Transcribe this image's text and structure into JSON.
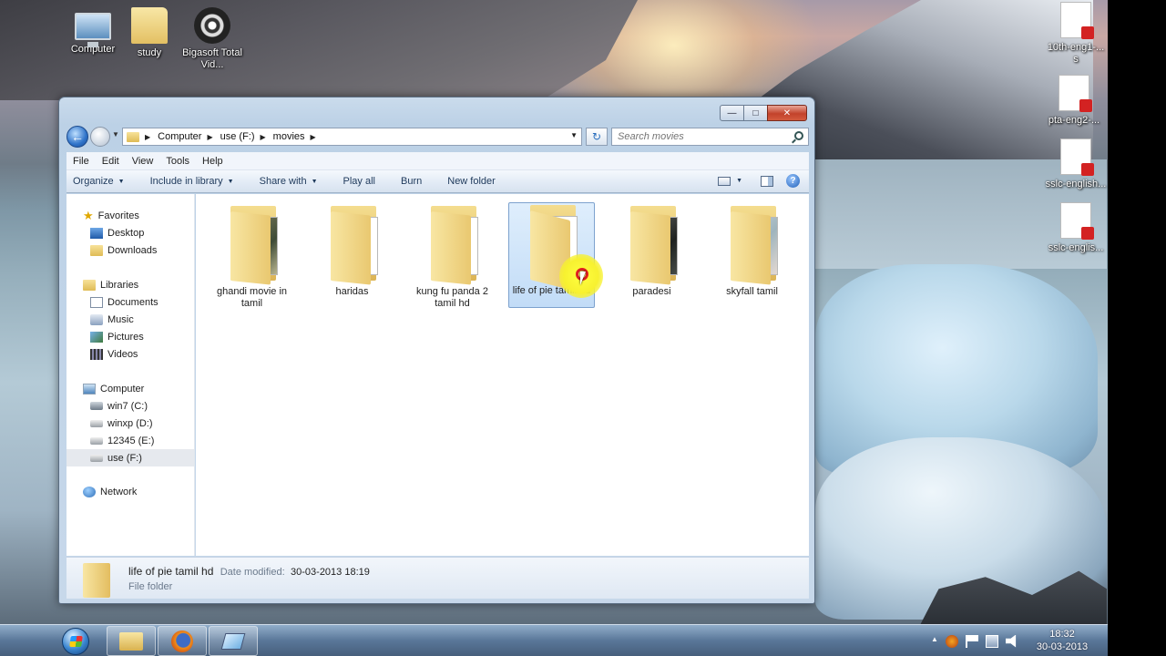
{
  "desktop": {
    "icons": [
      {
        "label": "Computer"
      },
      {
        "label": "study"
      },
      {
        "label": "Bigasoft Total Vid..."
      },
      {
        "label": "10th-eng1-... s"
      },
      {
        "label": "pta-eng2-..."
      },
      {
        "label": "sslc-english..."
      },
      {
        "label": "sslc-englis..."
      }
    ]
  },
  "window": {
    "caption": {
      "minimize": "—",
      "maximize": "□",
      "close": "✕"
    },
    "nav": {
      "back": "←"
    },
    "breadcrumb": [
      "Computer",
      "use (F:)",
      "movies"
    ],
    "refresh": "↻",
    "search": {
      "placeholder": "Search movies",
      "value": ""
    },
    "menu": [
      "File",
      "Edit",
      "View",
      "Tools",
      "Help"
    ],
    "commands": [
      {
        "label": "Organize",
        "dropdown": true
      },
      {
        "label": "Include in library",
        "dropdown": true
      },
      {
        "label": "Share with",
        "dropdown": true
      },
      {
        "label": "Play all",
        "dropdown": false
      },
      {
        "label": "Burn",
        "dropdown": false
      },
      {
        "label": "New folder",
        "dropdown": false
      }
    ],
    "help": "?",
    "nav_pane": {
      "favorites": {
        "label": "Favorites",
        "items": [
          "Desktop",
          "Downloads"
        ]
      },
      "libraries": {
        "label": "Libraries",
        "items": [
          "Documents",
          "Music",
          "Pictures",
          "Videos"
        ]
      },
      "computer": {
        "label": "Computer",
        "items": [
          "win7 (C:)",
          "winxp (D:)",
          "12345 (E:)",
          "use (F:)"
        ]
      },
      "network": {
        "label": "Network"
      },
      "selected": "use (F:)"
    },
    "files": [
      {
        "name": "ghandi movie in tamil",
        "preview": "photo",
        "selected": false
      },
      {
        "name": "haridas",
        "preview": "vlc",
        "selected": false
      },
      {
        "name": "kung fu panda 2 tamil hd",
        "preview": "media",
        "selected": false
      },
      {
        "name": "life of pie tamil hd",
        "preview": "media",
        "selected": true
      },
      {
        "name": "paradesi",
        "preview": "dark-photo",
        "selected": false
      },
      {
        "name": "skyfall tamil",
        "preview": "light-photo",
        "selected": false
      }
    ],
    "details": {
      "name": "life of pie tamil hd",
      "modified_label": "Date modified:",
      "modified_value": "30-03-2013 18:19",
      "type": "File folder"
    }
  },
  "taskbar": {
    "apps": [
      "windows-explorer",
      "firefox",
      "other-app"
    ],
    "time": "18:32",
    "date": "30-03-2013"
  }
}
